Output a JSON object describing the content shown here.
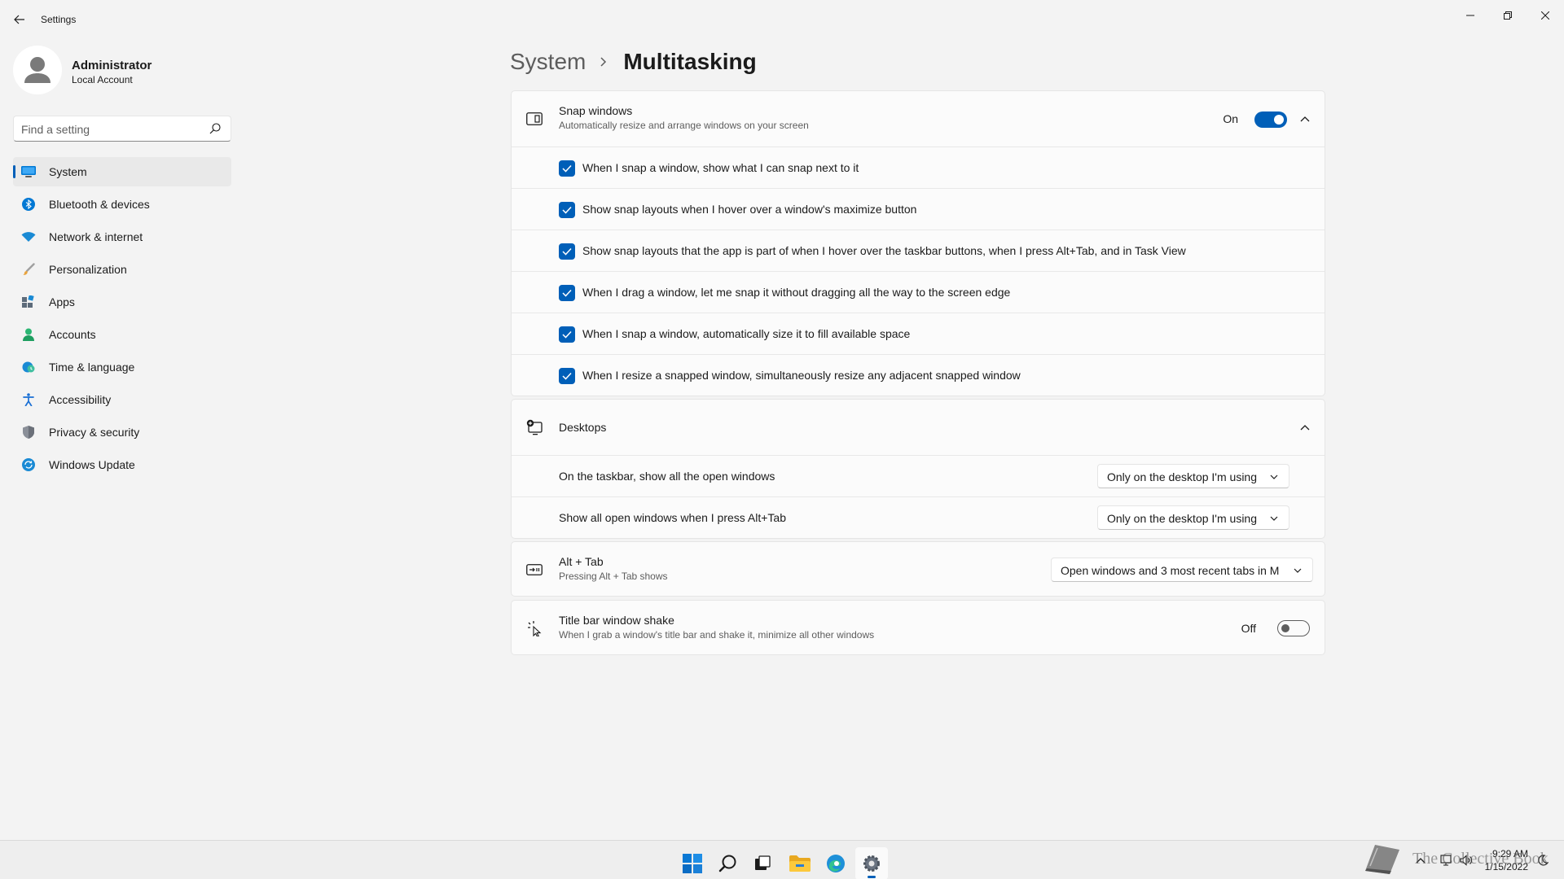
{
  "window": {
    "title": "Settings"
  },
  "profile": {
    "name": "Administrator",
    "account_type": "Local Account"
  },
  "search": {
    "placeholder": "Find a setting"
  },
  "nav": {
    "items": [
      {
        "label": "System",
        "icon": "system-icon",
        "active": true
      },
      {
        "label": "Bluetooth & devices",
        "icon": "bluetooth-icon"
      },
      {
        "label": "Network & internet",
        "icon": "wifi-icon"
      },
      {
        "label": "Personalization",
        "icon": "brush-icon"
      },
      {
        "label": "Apps",
        "icon": "apps-icon"
      },
      {
        "label": "Accounts",
        "icon": "person-icon"
      },
      {
        "label": "Time & language",
        "icon": "globe-clock-icon"
      },
      {
        "label": "Accessibility",
        "icon": "accessibility-icon"
      },
      {
        "label": "Privacy & security",
        "icon": "shield-icon"
      },
      {
        "label": "Windows Update",
        "icon": "update-icon"
      }
    ]
  },
  "header": {
    "parent": "System",
    "current": "Multitasking"
  },
  "snap": {
    "title": "Snap windows",
    "subtitle": "Automatically resize and arrange windows on your screen",
    "state_label": "On",
    "enabled": true,
    "options": [
      {
        "label": "When I snap a window, show what I can snap next to it",
        "checked": true
      },
      {
        "label": "Show snap layouts when I hover over a window's maximize button",
        "checked": true
      },
      {
        "label": "Show snap layouts that the app is part of when I hover over the taskbar buttons, when I press Alt+Tab, and in Task View",
        "checked": true
      },
      {
        "label": "When I drag a window, let me snap it without dragging all the way to the screen edge",
        "checked": true
      },
      {
        "label": "When I snap a window, automatically size it to fill available space",
        "checked": true
      },
      {
        "label": "When I resize a snapped window, simultaneously resize any adjacent snapped window",
        "checked": true
      }
    ]
  },
  "desktops": {
    "title": "Desktops",
    "rows": [
      {
        "label": "On the taskbar, show all the open windows",
        "value": "Only on the desktop I'm using"
      },
      {
        "label": "Show all open windows when I press Alt+Tab",
        "value": "Only on the desktop I'm using"
      }
    ]
  },
  "alttab": {
    "title": "Alt + Tab",
    "subtitle": "Pressing Alt + Tab shows",
    "value": "Open windows and 3 most recent tabs in M"
  },
  "shake": {
    "title": "Title bar window shake",
    "subtitle": "When I grab a window's title bar and shake it, minimize all other windows",
    "state_label": "Off",
    "enabled": false
  },
  "taskbar": {
    "time": "9:29 AM",
    "date": "1/15/2022"
  },
  "watermark": {
    "text": "The Collective Book"
  },
  "colors": {
    "accent": "#005fb8",
    "background": "#f3f3f3",
    "card": "#fbfbfb"
  }
}
